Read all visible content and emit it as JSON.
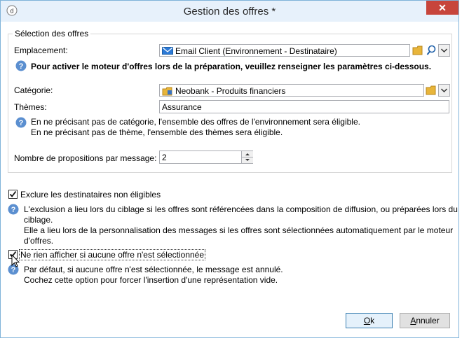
{
  "window": {
    "title": "Gestion des offres *",
    "close_glyph": "✕"
  },
  "selection": {
    "legend": "Sélection des offres",
    "emplacement_label": "Emplacement:",
    "emplacement_value": "Email Client (Environnement - Destinataire)",
    "info_bold": "Pour activer le moteur d'offres lors de la préparation, veuillez renseigner les paramètres ci-dessous.",
    "categorie_label": "Catégorie:",
    "categorie_value": "Neobank - Produits financiers",
    "themes_label": "Thèmes:",
    "themes_value": "Assurance",
    "help_line1": "En ne précisant pas de catégorie, l'ensemble des offres de l'environnement sera éligible.",
    "help_line2": "En ne précisant pas de thème, l'ensemble des thèmes sera éligible.",
    "nb_label": "Nombre de propositions par message:",
    "nb_value": "2"
  },
  "exclude": {
    "checked": true,
    "label": "Exclure les destinataires non éligibles",
    "help_line1": "L'exclusion a lieu lors du ciblage si les offres sont référencées dans la composition de diffusion, ou préparées lors du",
    "help_line2": "ciblage.",
    "help_line3": "Elle a lieu lors de la personnalisation des messages si les offres sont sélectionnées automatiquement par le moteur",
    "help_line4": "d'offres."
  },
  "noshow": {
    "checked": true,
    "label": "Ne rien afficher si aucune offre n'est sélectionnée",
    "help_line1": "Par défaut, si aucune offre n'est sélectionnée, le message est annulé.",
    "help_line2": "Cochez cette option pour forcer l'insertion d'une représentation vide."
  },
  "buttons": {
    "ok_prefix": "O",
    "ok_rest": "k",
    "cancel_prefix": "A",
    "cancel_rest": "nnuler"
  },
  "colors": {
    "accent": "#1e6fbf",
    "help_icon": "#5b8fd0",
    "folder": "#e8b53a",
    "close": "#c7453b"
  }
}
